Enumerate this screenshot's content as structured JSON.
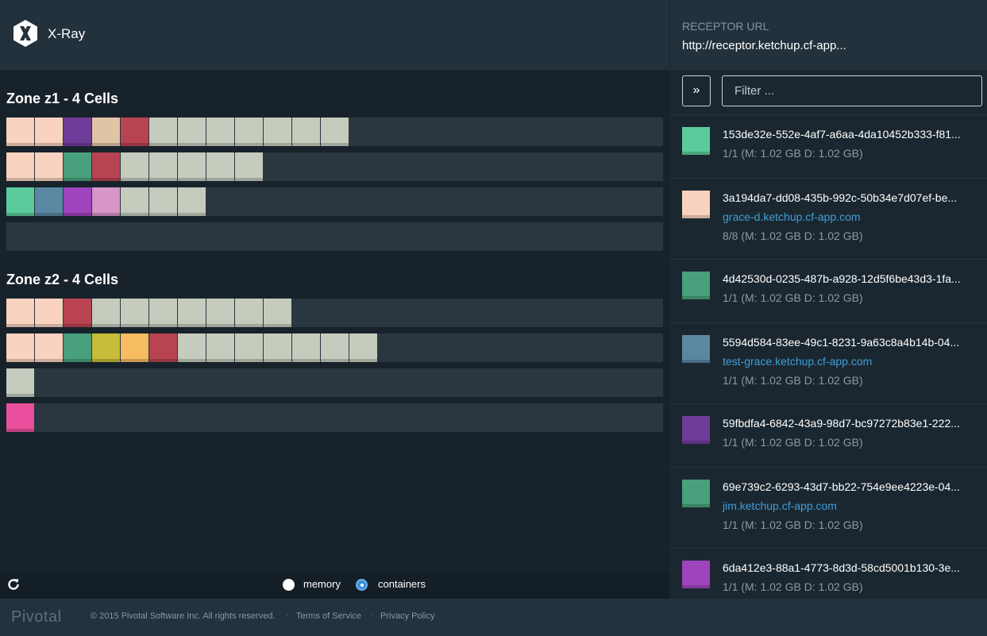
{
  "app": {
    "title": "X-Ray"
  },
  "zones": [
    {
      "title": "Zone z1 - 4 Cells",
      "cells": [
        [
          "#f9d3bf",
          "#f9d3bf",
          "#6f3c9a",
          "#e0c4a6",
          "#b84351",
          "#c5cbbd",
          "#c5cbbd",
          "#c5cbbd",
          "#c5cbbd",
          "#c5cbbd",
          "#c5cbbd",
          "#c5cbbd"
        ],
        [
          "#f9d3bf",
          "#f9d3bf",
          "#48a07d",
          "#b84351",
          "#c5cbbd",
          "#c5cbbd",
          "#c5cbbd",
          "#c5cbbd",
          "#c5cbbd"
        ],
        [
          "#5ccb9c",
          "#5a88a2",
          "#9e44bc",
          "#d795c8",
          "#c5cbbd",
          "#c5cbbd",
          "#c5cbbd"
        ],
        []
      ]
    },
    {
      "title": "Zone z2 - 4 Cells",
      "cells": [
        [
          "#f9d3bf",
          "#f9d3bf",
          "#b84351",
          "#c5cbbd",
          "#c5cbbd",
          "#c5cbbd",
          "#c5cbbd",
          "#c5cbbd",
          "#c5cbbd",
          "#c5cbbd"
        ],
        [
          "#f9d3bf",
          "#f9d3bf",
          "#48a07d",
          "#c7bd39",
          "#f6bc5f",
          "#b84351",
          "#c5cbbd",
          "#c5cbbd",
          "#c5cbbd",
          "#c5cbbd",
          "#c5cbbd",
          "#c5cbbd",
          "#c5cbbd"
        ],
        [
          "#c5cbbd"
        ],
        [
          "#e94f9d"
        ]
      ]
    }
  ],
  "controls": {
    "refresh_icon": "refresh-icon",
    "memory_label": "memory",
    "containers_label": "containers",
    "selected_mode": "containers"
  },
  "footer": {
    "brand": "Pivotal",
    "copyright": "© 2015 Pivotal Software Inc. All rights reserved.",
    "separator": "·",
    "terms": "Terms of Service",
    "privacy": "Privacy Policy"
  },
  "receptor": {
    "label": "RECEPTOR URL",
    "url": "http://receptor.ketchup.cf-app..."
  },
  "sidebar": {
    "toggle_label": "»",
    "filter_placeholder": "Filter ...",
    "apps": [
      {
        "color": "#5ccb9c",
        "guid": "153de32e-552e-4af7-a6aa-4da10452b333-f81...",
        "route": "",
        "stats": "1/1 (M: 1.02 GB D: 1.02 GB)"
      },
      {
        "color": "#f9d3bf",
        "guid": "3a194da7-dd08-435b-992c-50b34e7d07ef-be...",
        "route": "grace-d.ketchup.cf-app.com",
        "stats": "8/8 (M: 1.02 GB D: 1.02 GB)"
      },
      {
        "color": "#48a07d",
        "guid": "4d42530d-0235-487b-a928-12d5f6be43d3-1fa...",
        "route": "",
        "stats": "1/1 (M: 1.02 GB D: 1.02 GB)"
      },
      {
        "color": "#5a88a2",
        "guid": "5594d584-83ee-49c1-8231-9a63c8a4b14b-04...",
        "route": "test-grace.ketchup.cf-app.com",
        "stats": "1/1 (M: 1.02 GB D: 1.02 GB)"
      },
      {
        "color": "#6f3c9a",
        "guid": "59fbdfa4-6842-43a9-98d7-bc97272b83e1-222...",
        "route": "",
        "stats": "1/1 (M: 1.02 GB D: 1.02 GB)"
      },
      {
        "color": "#48a07d",
        "guid": "69e739c2-6293-43d7-bb22-754e9ee4223e-04...",
        "route": "jim.ketchup.cf-app.com",
        "stats": "1/1 (M: 1.02 GB D: 1.02 GB)"
      },
      {
        "color": "#9e44bc",
        "guid": "6da412e3-88a1-4773-8d3d-58cd5001b130-3e...",
        "route": "",
        "stats": "1/1 (M: 1.02 GB D: 1.02 GB)"
      }
    ]
  }
}
